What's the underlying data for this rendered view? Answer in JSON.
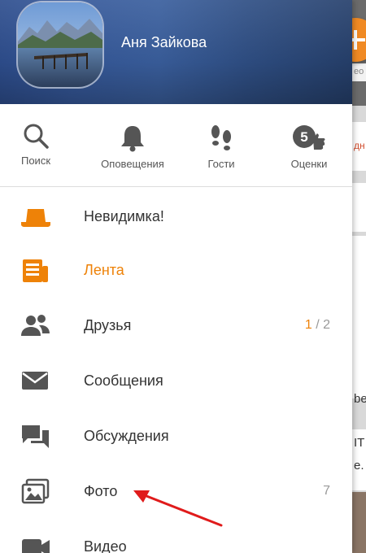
{
  "colors": {
    "accent": "#ee8208",
    "text": "#333333",
    "icon": "#555555",
    "arrow": "#e01b1b"
  },
  "profile": {
    "name": "Аня Зайкова"
  },
  "background_app": {
    "snippets": [
      "ео",
      "дн",
      "be",
      "IT",
      "e."
    ]
  },
  "quick_actions": [
    {
      "id": "search",
      "icon": "magnifier-icon",
      "label": "Поиск"
    },
    {
      "id": "notifications",
      "icon": "bell-icon",
      "label": "Оповещения"
    },
    {
      "id": "guests",
      "icon": "footprints-icon",
      "label": "Гости"
    },
    {
      "id": "ratings",
      "icon": "five-plus-icon",
      "label": "Оценки"
    }
  ],
  "menu": [
    {
      "id": "invisible",
      "icon": "hat-icon",
      "label": "Невидимка!",
      "active": false
    },
    {
      "id": "feed",
      "icon": "news-icon",
      "label": "Лента",
      "active": true
    },
    {
      "id": "friends",
      "icon": "people-icon",
      "label": "Друзья",
      "count_new": "1",
      "count_sep": " / ",
      "count_total": "2"
    },
    {
      "id": "messages",
      "icon": "envelope-icon",
      "label": "Сообщения"
    },
    {
      "id": "discussions",
      "icon": "chat-bubbles-icon",
      "label": "Обсуждения"
    },
    {
      "id": "photos",
      "icon": "photos-icon",
      "label": "Фото",
      "count": "7"
    },
    {
      "id": "video",
      "icon": "video-camera-icon",
      "label": "Видео"
    }
  ]
}
